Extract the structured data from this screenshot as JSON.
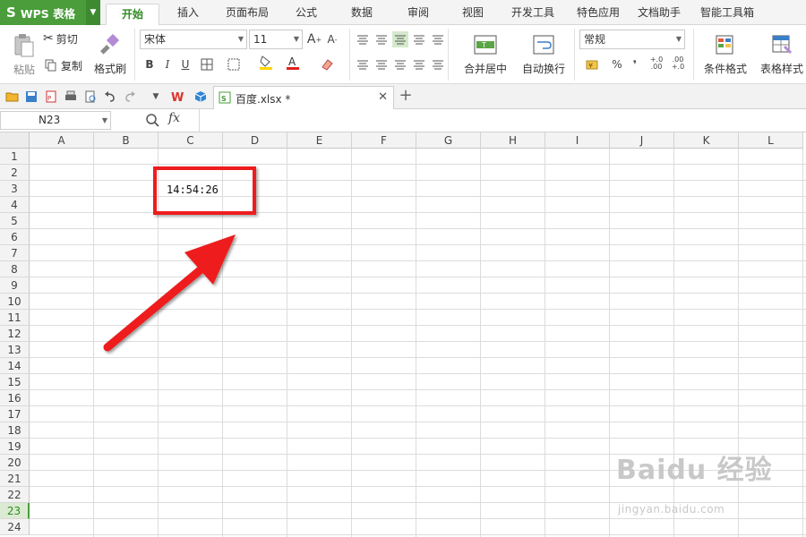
{
  "app": {
    "logo_letter": "S",
    "logo_text": "WPS 表格"
  },
  "tabs": [
    "开始",
    "插入",
    "页面布局",
    "公式",
    "数据",
    "审阅",
    "视图",
    "开发工具",
    "特色应用",
    "文档助手",
    "智能工具箱"
  ],
  "ribbon": {
    "paste": "粘贴",
    "cut": "剪切",
    "copy": "复制",
    "format_painter": "格式刷",
    "font_name": "宋体",
    "font_size": "11",
    "bold": "B",
    "italic": "I",
    "underline": "U",
    "merge_center": "合并居中",
    "wrap_text": "自动换行",
    "number_format": "常规",
    "percent": "%",
    "comma": "❜",
    "inc_decimal": "+.0 .00",
    "dec_decimal": ".00 +.0",
    "conditional_format": "条件格式",
    "table_style": "表格样式"
  },
  "document": {
    "tab_name": "百度.xlsx *",
    "add_tab": "+"
  },
  "formula_bar": {
    "name_box": "N23",
    "fx": "fx",
    "content": ""
  },
  "sheet": {
    "columns": [
      "A",
      "B",
      "C",
      "D",
      "E",
      "F",
      "G",
      "H",
      "I",
      "J",
      "K",
      "L"
    ],
    "rows": [
      "1",
      "2",
      "3",
      "4",
      "5",
      "6",
      "7",
      "8",
      "9",
      "10",
      "11",
      "12",
      "13",
      "14",
      "15",
      "16",
      "17",
      "18",
      "19",
      "20",
      "21",
      "22",
      "23",
      "24"
    ],
    "selected_row": "23",
    "cell_c3": "14:54:26"
  },
  "annotation_color": "#ee1c1c",
  "accent_color": "#4a9d3a",
  "watermark": {
    "main": "Baidu 经验",
    "sub": "jingyan.baidu.com"
  }
}
